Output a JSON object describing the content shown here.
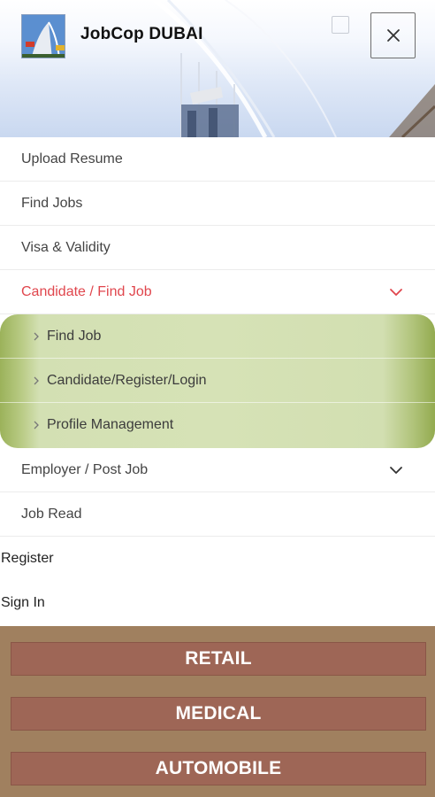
{
  "header": {
    "brand": "JobCop DUBAI",
    "logo_icon": "burj-al-arab-logo-icon",
    "close_icon": "close-icon"
  },
  "menu": {
    "items": [
      {
        "label": "Upload Resume"
      },
      {
        "label": "Find Jobs"
      },
      {
        "label": "Visa & Validity"
      },
      {
        "label": "Candidate / Find Job",
        "expanded": true,
        "active_color": "#e0464d"
      },
      {
        "label": "Employer / Post Job",
        "expanded": false
      },
      {
        "label": "Job Read"
      },
      {
        "label": "Register"
      },
      {
        "label": "Sign In"
      }
    ],
    "candidate_submenu": [
      {
        "label": "Find Job"
      },
      {
        "label": "Candidate/Register/Login"
      },
      {
        "label": "Profile Management"
      }
    ]
  },
  "categories": [
    {
      "label": "RETAIL"
    },
    {
      "label": "MEDICAL"
    },
    {
      "label": "AUTOMOBILE"
    }
  ],
  "colors": {
    "active_text": "#e0464d",
    "submenu_bg": "#d6e2b6",
    "category_strip": "#a0805f",
    "category_button": "#9e6656"
  }
}
